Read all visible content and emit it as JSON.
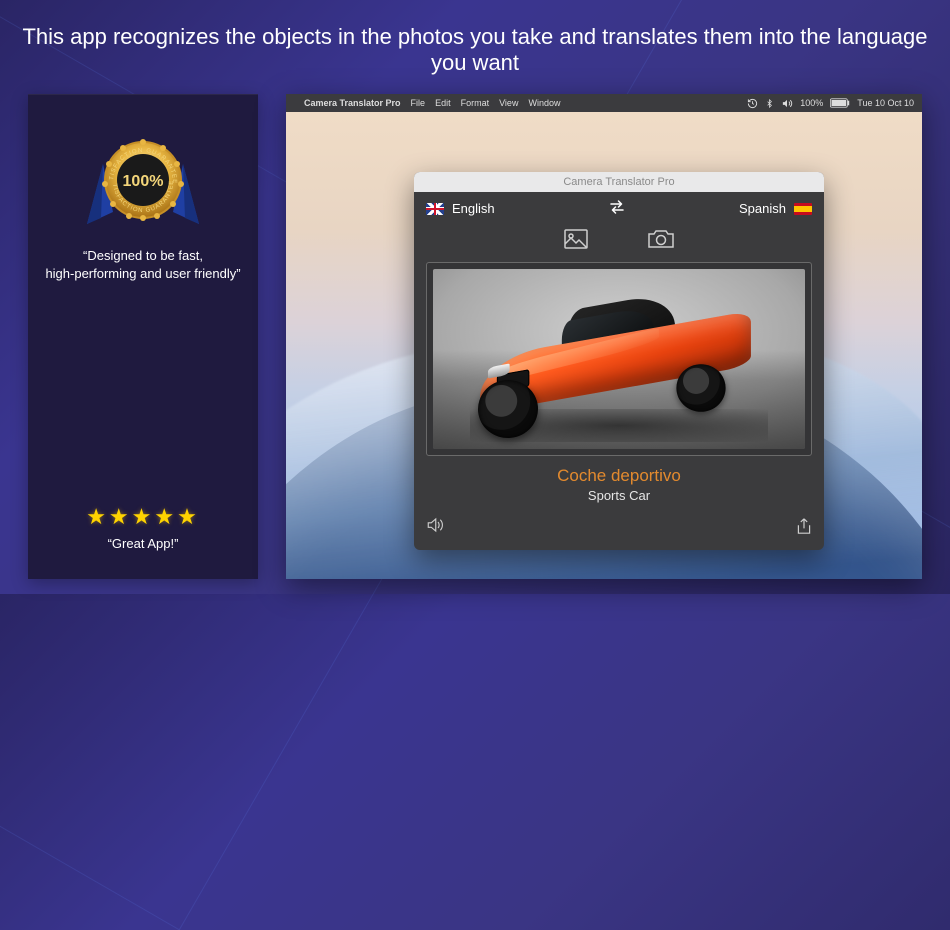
{
  "headline": "This app recognizes the objects in the photos you take and translates them into the language you want",
  "sidebar": {
    "seal_percent": "100%",
    "seal_top": "SATISFACTION GUARANTEED",
    "seal_bottom": "SATISFACTION GUARANTEED",
    "quote1_line1": "“Designed to be fast,",
    "quote1_line2": "high-performing and user friendly”",
    "stars": "★★★★★",
    "quote2": "“Great App!”"
  },
  "menubar": {
    "app": "Camera Translator Pro",
    "items": [
      "File",
      "Edit",
      "Format",
      "View",
      "Window"
    ],
    "battery_pct": "100%",
    "clock": "Tue 10 Oct  10"
  },
  "appwin": {
    "title": "Camera Translator Pro",
    "source_lang": "English",
    "target_lang": "Spanish",
    "translated": "Coche deportivo",
    "original": "Sports Car"
  }
}
